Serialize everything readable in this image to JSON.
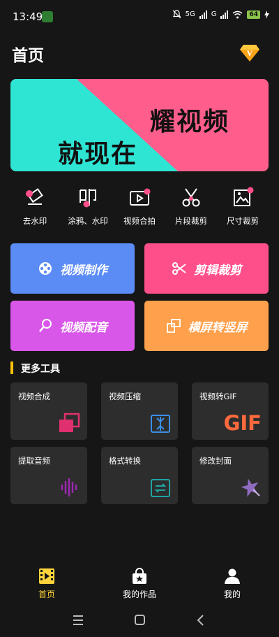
{
  "status_bar": {
    "time": "13:49",
    "network_1": "5G",
    "network_2": "G",
    "battery": "64"
  },
  "header": {
    "title": "首页",
    "vip_badge": "V"
  },
  "banner": {
    "line1": "耀视频",
    "line2": "就现在",
    "colors": [
      "#2ee5d4",
      "#ff5e8c"
    ]
  },
  "quick_actions": [
    {
      "label": "去水印",
      "icon": "eraser-icon"
    },
    {
      "label": "涂鸦、水印",
      "icon": "stamp-icon"
    },
    {
      "label": "视频合拍",
      "icon": "video-camera-icon"
    },
    {
      "label": "片段裁剪",
      "icon": "scissors-icon"
    },
    {
      "label": "尺寸裁剪",
      "icon": "image-crop-icon"
    }
  ],
  "main_cards": [
    {
      "label": "视频制作",
      "color": "#5b8cf5",
      "icon": "film-reel-icon"
    },
    {
      "label": "剪辑裁剪",
      "color": "#ff4f8b",
      "icon": "scissors-icon"
    },
    {
      "label": "视频配音",
      "color": "#d957e8",
      "icon": "microphone-icon"
    },
    {
      "label": "横屏转竖屏",
      "color": "#ffa04c",
      "icon": "rotate-screen-icon"
    }
  ],
  "more_tools": {
    "title": "更多工具",
    "items": [
      {
        "label": "视频合成",
        "icon": "merge-icon"
      },
      {
        "label": "视频压缩",
        "icon": "compress-icon"
      },
      {
        "label": "视频转GIF",
        "icon": "gif-icon",
        "icon_text": "GIF"
      },
      {
        "label": "提取音频",
        "icon": "waveform-icon"
      },
      {
        "label": "格式转换",
        "icon": "convert-icon"
      },
      {
        "label": "修改封面",
        "icon": "star-cover-icon"
      }
    ]
  },
  "tabs": [
    {
      "label": "首页",
      "icon": "film-icon",
      "active": true
    },
    {
      "label": "我的作品",
      "icon": "bag-star-icon",
      "active": false
    },
    {
      "label": "我的",
      "icon": "user-icon",
      "active": false
    }
  ],
  "colors": {
    "background": "#161616",
    "accent": "#ffc107",
    "tool_bg": "#2d2d2d"
  }
}
